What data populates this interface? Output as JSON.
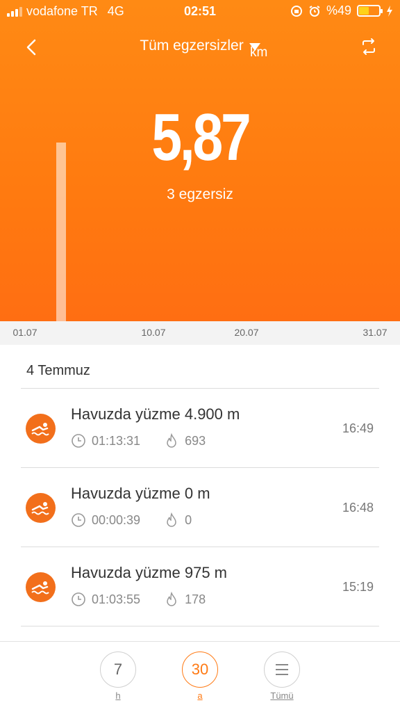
{
  "status_bar": {
    "carrier": "vodafone TR",
    "network": "4G",
    "time": "02:51",
    "battery_percent": "%49",
    "battery_level": 0.49
  },
  "nav": {
    "title": "Tüm egzersizler",
    "icons": {
      "back": "chevron-left-icon",
      "dropdown": "triangle-down-icon",
      "switch": "repeat-icon"
    }
  },
  "summary": {
    "total_value": "5,87",
    "unit": "km",
    "count_text": "3 egzersiz"
  },
  "chart_data": {
    "type": "bar",
    "x_ticks": [
      "01.07",
      "10.07",
      "20.07",
      "31.07"
    ],
    "bars": [
      {
        "day": "04.07",
        "value": 5.87
      }
    ],
    "ylim": [
      0,
      10.56
    ]
  },
  "section": {
    "date": "4 Temmuz"
  },
  "workouts": [
    {
      "title": "Havuzda yüzme 4.900 m",
      "duration": "01:13:31",
      "calories": "693",
      "time": "16:49"
    },
    {
      "title": "Havuzda yüzme 0 m",
      "duration": "00:00:39",
      "calories": "0",
      "time": "16:48"
    },
    {
      "title": "Havuzda yüzme 975 m",
      "duration": "01:03:55",
      "calories": "178",
      "time": "15:19"
    }
  ],
  "tabs": [
    {
      "value": "7",
      "label": "h",
      "active": false
    },
    {
      "value": "30",
      "label": "a",
      "active": true
    },
    {
      "value": "",
      "label": "Tümü",
      "active": false
    }
  ],
  "colors": {
    "accent": "#ff7a14",
    "icon_bg": "#f26f1b",
    "battery": "#ffd21a"
  }
}
